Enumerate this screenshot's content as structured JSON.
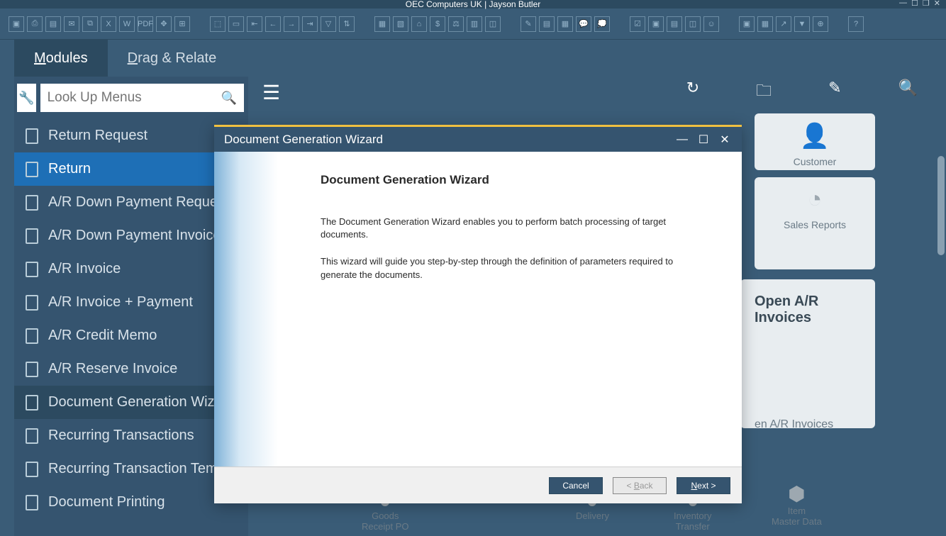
{
  "app": {
    "title": "OEC Computers UK | Jayson Butler"
  },
  "tabs": {
    "modules": "Modules",
    "drag_relate": "Drag & Relate"
  },
  "search": {
    "placeholder": "Look Up Menus"
  },
  "menu": {
    "items": [
      "Return Request",
      "Return",
      "A/R Down Payment Request",
      "A/R Down Payment Invoice",
      "A/R Invoice",
      "A/R Invoice + Payment",
      "A/R Credit Memo",
      "A/R Reserve Invoice",
      "Document Generation Wizard",
      "Recurring Transactions",
      "Recurring Transaction Templates",
      "Document Printing"
    ]
  },
  "tiles": {
    "customer": "Customer",
    "sales_reports": "Sales Reports",
    "open_ar": "Open A/R Invoices",
    "open_ar2": "en A/R Invoices"
  },
  "flow": {
    "goods": "Goods\nReceipt PO",
    "delivery": "Delivery",
    "inventory": "Inventory\nTransfer",
    "item": "Item\nMaster Data"
  },
  "dialog": {
    "title": "Document Generation Wizard",
    "heading": "Document Generation Wizard",
    "p1": "The Document Generation Wizard enables you to perform batch processing of target documents.",
    "p2": "This wizard will guide you step-by-step through the definition of parameters required to generate the documents.",
    "cancel": "Cancel",
    "back": "< Back",
    "next": "Next >"
  }
}
